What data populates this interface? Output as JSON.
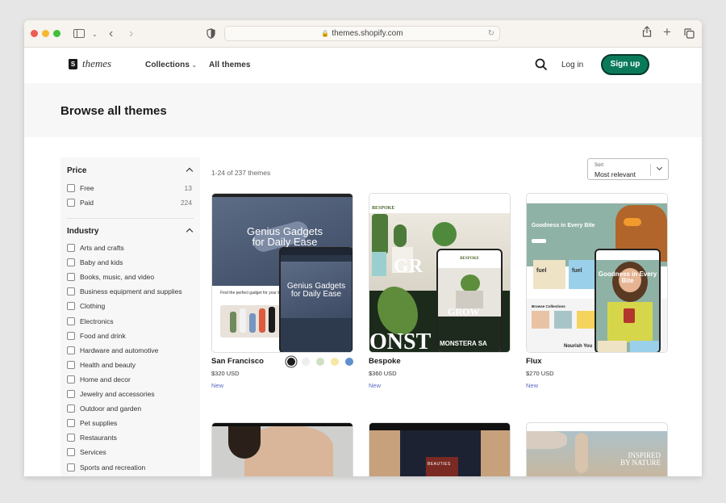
{
  "browser": {
    "url": "themes.shopify.com"
  },
  "header": {
    "logo_text": "themes",
    "nav": [
      {
        "label": "Collections"
      },
      {
        "label": "All themes"
      }
    ],
    "login_label": "Log in",
    "signup_label": "Sign up",
    "accent_color": "#0a7a5a"
  },
  "hero": {
    "title": "Browse all themes"
  },
  "filters": {
    "price": {
      "title": "Price",
      "options": [
        {
          "label": "Free",
          "count": "13"
        },
        {
          "label": "Paid",
          "count": "224"
        }
      ]
    },
    "industry": {
      "title": "Industry",
      "options": [
        {
          "label": "Arts and crafts"
        },
        {
          "label": "Baby and kids"
        },
        {
          "label": "Books, music, and video"
        },
        {
          "label": "Business equipment and supplies"
        },
        {
          "label": "Clothing"
        },
        {
          "label": "Electronics"
        },
        {
          "label": "Food and drink"
        },
        {
          "label": "Hardware and automotive"
        },
        {
          "label": "Health and beauty"
        },
        {
          "label": "Home and decor"
        },
        {
          "label": "Jewelry and accessories"
        },
        {
          "label": "Outdoor and garden"
        },
        {
          "label": "Pet supplies"
        },
        {
          "label": "Restaurants"
        },
        {
          "label": "Services"
        },
        {
          "label": "Sports and recreation"
        }
      ]
    }
  },
  "results": {
    "count_text": "1-24 of 237 themes",
    "sort": {
      "label": "Sort",
      "value": "Most relevant"
    }
  },
  "themes": [
    {
      "name": "San Francisco",
      "price": "$320 USD",
      "badge": "New",
      "preview_text": [
        "Genius Gadgets",
        "for Daily Ease"
      ],
      "preview_subtext": "Find the perfect gadget for your lifestyle",
      "swatches": [
        "#1a1a1a",
        "#eeeeee",
        "#cfe0c4",
        "#f6e7a2",
        "#5f8fd0"
      ]
    },
    {
      "name": "Bespoke",
      "price": "$360 USD",
      "badge": "New",
      "preview_brand": "BESPOKE",
      "preview_text": [
        "GR",
        "ONST",
        "GROW",
        "MONSTERA SA"
      ]
    },
    {
      "name": "Flux",
      "price": "$270 USD",
      "badge": "New",
      "preview_text": [
        "Goodness in Every Bite",
        "Browse Collections",
        "Nourish You"
      ],
      "preview_brand": "fuel"
    },
    {
      "preview_text": []
    },
    {
      "preview_text": [
        "BEAUTIES"
      ]
    },
    {
      "preview_text": [
        "INSPIRED",
        "BY NATURE"
      ]
    }
  ]
}
